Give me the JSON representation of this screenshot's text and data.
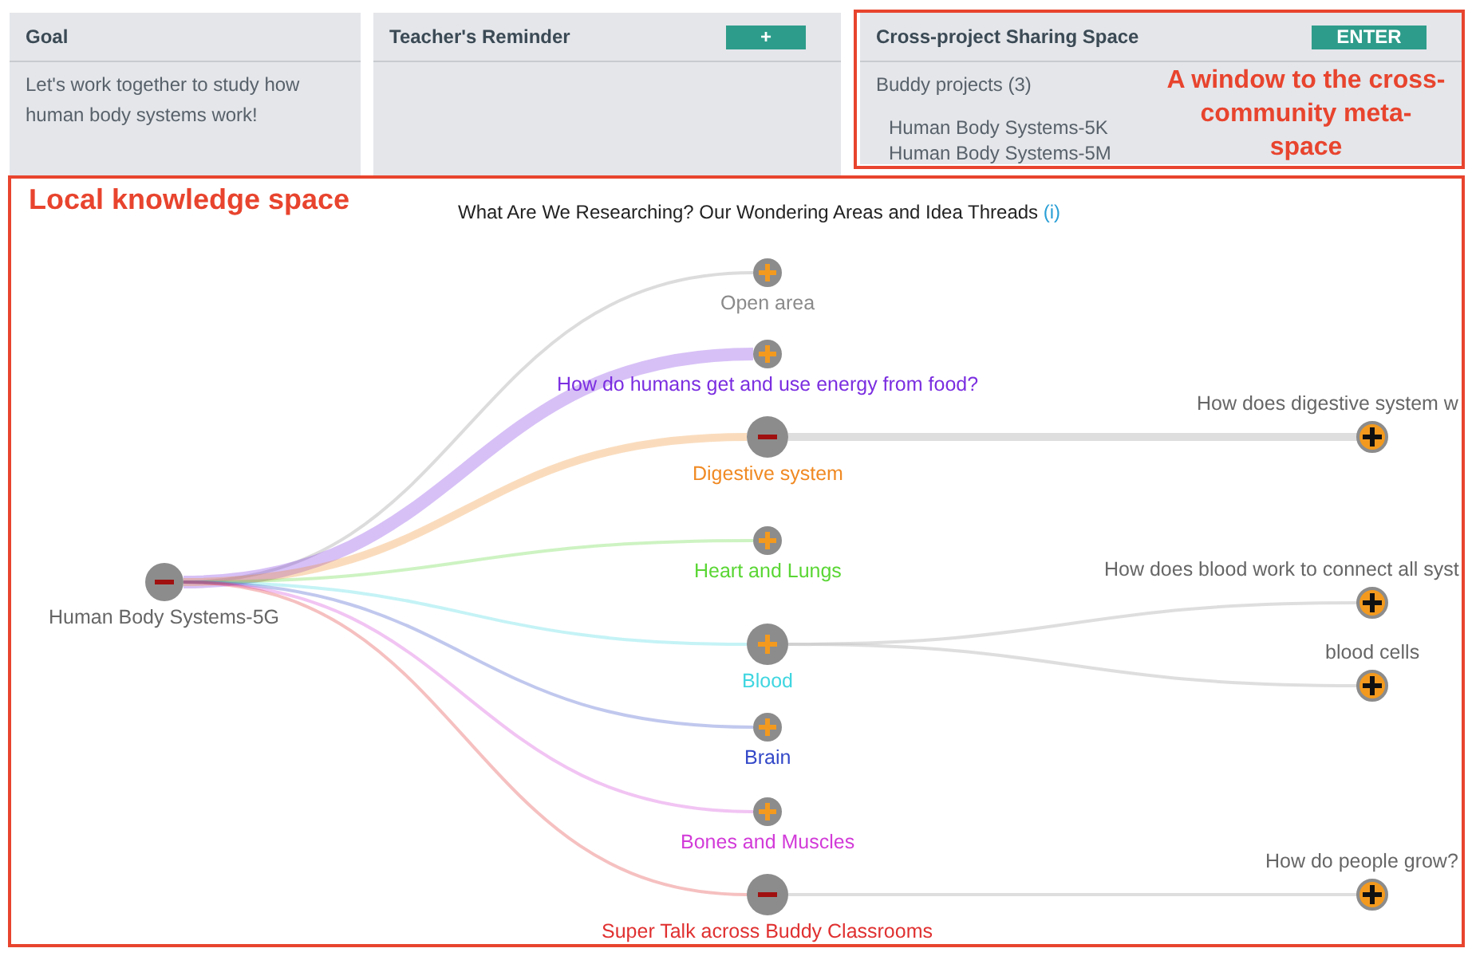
{
  "panels": [
    {
      "title": "Goal",
      "text": "Let's work together to study how human body systems work!"
    },
    {
      "title": "Teacher's Reminder",
      "button": "+"
    },
    {
      "title": "Cross-project Sharing Space",
      "button": "ENTER",
      "subtitle": "Buddy projects (3)",
      "items": [
        "Human Body Systems-5K",
        "Human Body Systems-5M"
      ],
      "annotation": "A window to the cross-community meta-space"
    }
  ],
  "knowledge_space": {
    "annotation": "Local knowledge space",
    "title": "What Are We Researching? Our Wondering Areas and Idea Threads",
    "info": "(i)",
    "root": {
      "label": "Human Body Systems-5G",
      "expanded": true,
      "children": [
        {
          "label": "Open area",
          "color": "#8a8a8a",
          "expanded": false
        },
        {
          "label": "How do humans get and use energy from food?",
          "color": "#7b2ee0",
          "expanded": false
        },
        {
          "label": "Digestive system",
          "color": "#f08a24",
          "expanded": true,
          "children": [
            {
              "label": "How does digestive system w"
            }
          ]
        },
        {
          "label": "Heart and Lungs",
          "color": "#5ad634",
          "expanded": false
        },
        {
          "label": "Blood",
          "color": "#3fd6e0",
          "expanded": false,
          "children": [
            {
              "label": "How does blood work to connect all syst"
            },
            {
              "label": "blood cells"
            }
          ]
        },
        {
          "label": "Brain",
          "color": "#3348c8",
          "expanded": false
        },
        {
          "label": "Bones and Muscles",
          "color": "#d23ad8",
          "expanded": false
        },
        {
          "label": "Super Talk across Buddy Classrooms",
          "color": "#e03030",
          "expanded": true,
          "children": [
            {
              "label": "How do people grow?"
            }
          ]
        }
      ]
    }
  }
}
